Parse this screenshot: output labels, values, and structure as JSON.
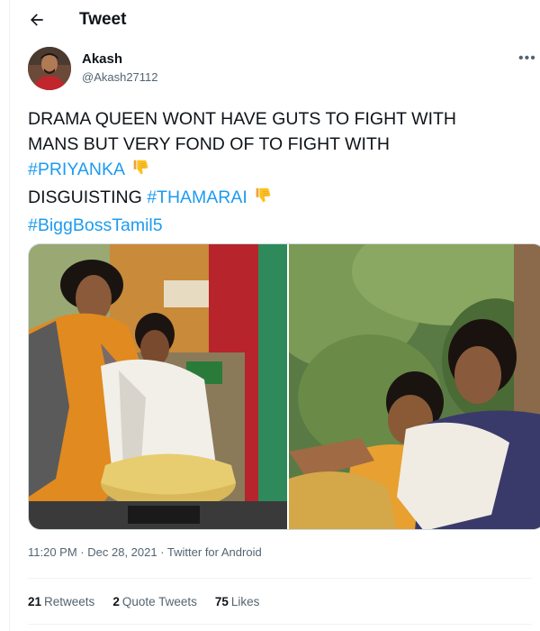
{
  "header": {
    "title": "Tweet"
  },
  "author": {
    "name": "Akash",
    "handle": "@Akash27112"
  },
  "tweet": {
    "line1": "DRAMA QUEEN WONT HAVE GUTS TO FIGHT WITH",
    "line2": "MANS BUT VERY FOND OF TO FIGHT WITH",
    "tag_priyanka": "#PRIYANKA",
    "line4_text": "DISGUISTING ",
    "tag_thamarai": "#THAMARAI",
    "tag_biggboss": "#BiggBossTamil5",
    "emoji_icon": "thumbs-down-icon"
  },
  "meta": {
    "time": "11:20 PM",
    "separator1": " · ",
    "date": "Dec 28, 2021",
    "separator2": " · ",
    "source": "Twitter for Android"
  },
  "stats": {
    "retweets_count": "21",
    "retweets_label": "Retweets",
    "quotes_count": "2",
    "quotes_label": "Quote Tweets",
    "likes_count": "75",
    "likes_label": "Likes"
  },
  "colors": {
    "link": "#1d9bf0",
    "text": "#0f1419",
    "secondary": "#536471"
  }
}
